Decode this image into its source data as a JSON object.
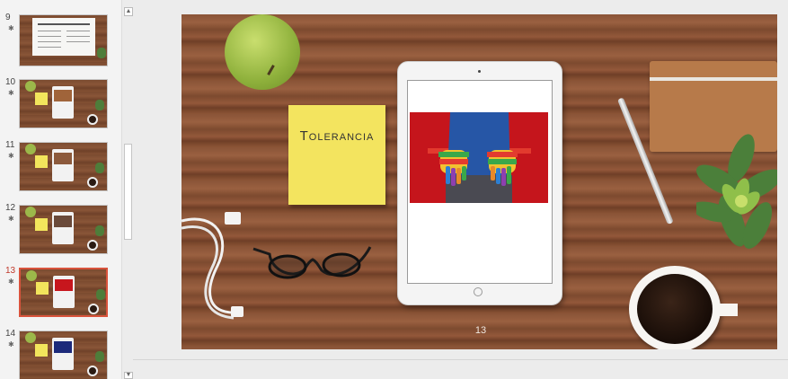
{
  "window": {
    "title": ""
  },
  "thumbnails": [
    {
      "number": "9",
      "marker": "✱",
      "selected": false,
      "variant": "text"
    },
    {
      "number": "10",
      "marker": "✱",
      "selected": false,
      "variant": "desk"
    },
    {
      "number": "11",
      "marker": "✱",
      "selected": false,
      "variant": "desk"
    },
    {
      "number": "12",
      "marker": "✱",
      "selected": false,
      "variant": "desk"
    },
    {
      "number": "13",
      "marker": "✱",
      "selected": true,
      "variant": "desk"
    },
    {
      "number": "14",
      "marker": "✱",
      "selected": false,
      "variant": "desk"
    }
  ],
  "scrollbar": {
    "up_icon": "▲",
    "down_icon": "▼"
  },
  "slide": {
    "sticky_note_text": "Tolerancia",
    "slide_number": "13",
    "background": "wood-desk",
    "image_subject": "rainbow-painted-hands"
  },
  "colors": {
    "selected_border": "#d9533c",
    "selected_number": "#c0392b",
    "sticky_note": "#f3e45f"
  }
}
